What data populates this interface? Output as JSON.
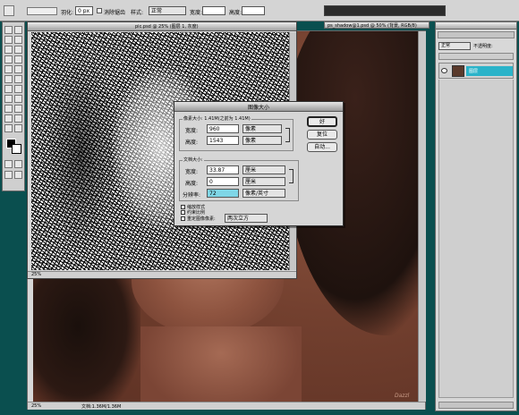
{
  "optionsbar": {
    "tool_label": "羽化:",
    "feather_value": "0 px",
    "antialias_label": "消除锯齿",
    "style_label": "样式:",
    "style_value": "正常",
    "width_label": "宽度:",
    "height_label": "高度:"
  },
  "topwindow": {
    "title": "ps_shadow@1.psd @ 50% (背景, RGB/8)"
  },
  "noise_doc": {
    "title": "pic.psd @ 25% (图层 1, 灰度)",
    "zoom": "25%"
  },
  "main_doc": {
    "zoom": "25%",
    "status": "文档:1.36M/1.36M",
    "signature": "Dazzl"
  },
  "dialog": {
    "title": "图像大小",
    "pixel_group_label": "像素大小: 1.41M(之前为 1.41M)",
    "width_label": "宽度:",
    "width_value": "960",
    "width_unit": "像素",
    "height_label": "高度:",
    "height_value": "1543",
    "height_unit": "像素",
    "doc_group_label": "文档大小:",
    "doc_width_label": "宽度:",
    "doc_width_value": "33.87",
    "doc_width_unit": "厘米",
    "doc_height_label": "高度:",
    "doc_height_value": "0",
    "doc_height_unit": "厘米",
    "resolution_label": "分辨率:",
    "resolution_value": "72",
    "resolution_unit": "像素/英寸",
    "scale_styles": "缩放样式",
    "constrain": "约束比例",
    "resample_label": "重定图像像素:",
    "resample_value": "两次立方",
    "ok_label": "好",
    "reset_label": "复位",
    "auto_label": "自动..."
  },
  "layers_panel": {
    "blend_mode": "正常",
    "opacity_label": "不透明度:",
    "layer_name": "图层"
  }
}
